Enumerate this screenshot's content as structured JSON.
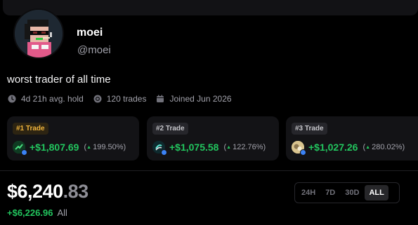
{
  "profile": {
    "name": "moei",
    "handle": "@moei",
    "bio": "worst trader of all time"
  },
  "stats": {
    "avg_hold": "4d 21h avg. hold",
    "trades": "120 trades",
    "joined": "Joined Jun 2026"
  },
  "top_trades": [
    {
      "rank": "#1 Trade",
      "amount": "+$1,807.69",
      "pct": "199.50%",
      "badge_color": "#f0b43c"
    },
    {
      "rank": "#2 Trade",
      "amount": "+$1,075.58",
      "pct": "122.76%",
      "badge_color": "#c4c4c8"
    },
    {
      "rank": "#3 Trade",
      "amount": "+$1,027.26",
      "pct": "280.02%",
      "badge_color": "#c4c4c8"
    }
  ],
  "portfolio": {
    "balance_whole": "$6,240",
    "balance_cents": ".83",
    "pnl": "+$6,226.96",
    "pnl_period": "All"
  },
  "range": {
    "options": [
      "24H",
      "7D",
      "30D",
      "ALL"
    ],
    "selected": "ALL"
  },
  "colors": {
    "background": "#000000",
    "card": "#131316",
    "positive": "#22c55e",
    "gold": "#f0b43c",
    "muted": "#a1a1aa"
  },
  "icons": {
    "avg_hold": "clock-icon",
    "trades": "coins-icon",
    "joined": "calendar-icon",
    "arrow": "triangle-up-icon",
    "verified": "verified-badge-icon"
  }
}
